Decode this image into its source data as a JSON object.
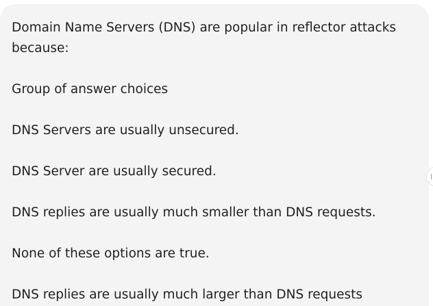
{
  "message": {
    "question": "Domain Name Servers (DNS) are popular in reflector attacks because:",
    "subheading": "Group of answer choices",
    "choices": [
      "DNS Servers are usually unsecured.",
      "DNS Server are usually secured.",
      "DNS replies are usually much smaller than DNS requests.",
      "None of these options are true.",
      "DNS replies are usually much larger than DNS requests"
    ]
  },
  "colors": {
    "bubble_background": "#f4f4f4",
    "text": "#1f1f1f"
  }
}
